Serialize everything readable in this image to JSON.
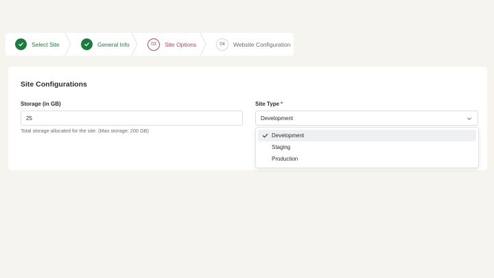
{
  "stepper": {
    "steps": [
      {
        "label": "Select Site",
        "state": "done"
      },
      {
        "label": "General Info",
        "state": "done"
      },
      {
        "number": "03",
        "label": "Site Options",
        "state": "active"
      },
      {
        "number": "04",
        "label": "Website Configuration",
        "state": "upcoming"
      }
    ]
  },
  "card": {
    "title": "Site Configurations",
    "storage": {
      "label": "Storage (in GB)",
      "value": "25",
      "help": "Total storage allocated for the site. (Max storage: 200 GB)"
    },
    "site_type": {
      "label": "Site Type",
      "required_mark": "*",
      "value": "Development",
      "options": [
        {
          "label": "Development",
          "selected": true
        },
        {
          "label": "Staging",
          "selected": false
        },
        {
          "label": "Production",
          "selected": false
        }
      ]
    }
  },
  "colors": {
    "done": "#1f7a3d",
    "active": "#b3426e",
    "background": "#f5f4ef"
  }
}
